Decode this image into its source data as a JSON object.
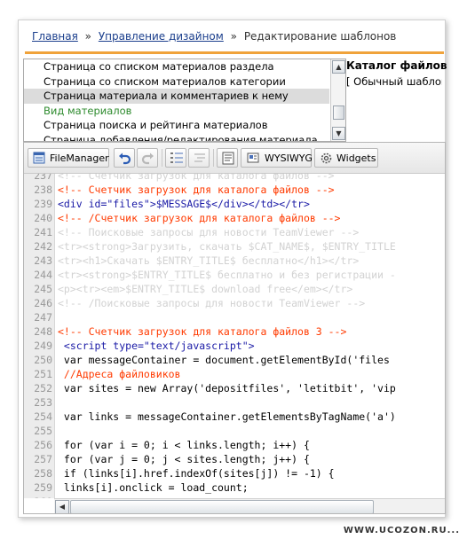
{
  "breadcrumb": {
    "home": "Главная",
    "sep1": "»",
    "design": "Управление дизайном",
    "sep2": "»",
    "current": "Редактирование шаблонов"
  },
  "template_list": {
    "items": [
      {
        "label": "Страница со списком материалов раздела"
      },
      {
        "label": "Страница со списком материалов категории"
      },
      {
        "label": "Страница материала и комментариев к нему"
      },
      {
        "label": "Вид материалов"
      },
      {
        "label": "Страница поиска и рейтинга материалов"
      },
      {
        "label": "Страница добавления/редактирования материала"
      }
    ],
    "selected_index": 2,
    "group_heading_index": 3,
    "scroll_up": "▲",
    "scroll_down": "▼"
  },
  "catalog": {
    "title": "Каталог файлов",
    "subtitle": "[ Обычный шаблон"
  },
  "toolbar": {
    "filemanager_label": "FileManager",
    "wysiwyg_label": "WYSIWYG",
    "widgets_label": "Widgets"
  },
  "code": {
    "lines": [
      {
        "n": "237",
        "t": "<!-- Счетчик загрузок для каталога файлов -->",
        "k": "faded"
      },
      {
        "n": "238",
        "t": "<!-- Счетчик загрузок для каталога файлов -->",
        "k": "comment"
      },
      {
        "n": "239",
        "t": "<div id=\"files\">$MESSAGE$</div></td></tr>",
        "k": "tag"
      },
      {
        "n": "240",
        "t": "<!-- /Счетчик загрузок для каталога файлов -->",
        "k": "comment"
      },
      {
        "n": "241",
        "t": "<!-- Поисковые запросы для новости TeamViewer -->",
        "k": "faded"
      },
      {
        "n": "242",
        "t": "<tr><strong>Загрузить, скачать $CAT_NAME$, $ENTRY_TITLE",
        "k": "faded"
      },
      {
        "n": "243",
        "t": "<tr><h1>Скачать $ENTRY_TITLE$ бесплатно</h1></tr>",
        "k": "faded"
      },
      {
        "n": "244",
        "t": "<tr><strong>$ENTRY_TITLE$ бесплатно и без регистрации -",
        "k": "faded"
      },
      {
        "n": "245",
        "t": "<p><tr><em>$ENTRY_TITLE$ download free</em></tr>",
        "k": "faded"
      },
      {
        "n": "246",
        "t": "<!-- /Поисковые запросы для новости TeamViewer -->",
        "k": "faded"
      },
      {
        "n": "247",
        "t": "",
        "k": "text"
      },
      {
        "n": "248",
        "t": "<!-- Счетчик загрузок для каталога файлов 3 -->",
        "k": "comment"
      },
      {
        "n": "249",
        "t": " <script type=\"text/javascript\">",
        "k": "tag"
      },
      {
        "n": "250",
        "t": " var messageContainer = document.getElementById('files",
        "k": "text"
      },
      {
        "n": "251",
        "t": " //Адреса файловиков",
        "k": "comment"
      },
      {
        "n": "252",
        "t": " var sites = new Array('depositfiles', 'letitbit', 'vip",
        "k": "text"
      },
      {
        "n": "253",
        "t": "",
        "k": "text"
      },
      {
        "n": "254",
        "t": " var links = messageContainer.getElementsByTagName('a')",
        "k": "text"
      },
      {
        "n": "255",
        "t": "",
        "k": "text"
      },
      {
        "n": "256",
        "t": " for (var i = 0; i < links.length; i++) {",
        "k": "text"
      },
      {
        "n": "257",
        "t": " for (var j = 0; j < sites.length; j++) {",
        "k": "text"
      },
      {
        "n": "258",
        "t": " if (links[i].href.indexOf(sites[j]) != -1) {",
        "k": "text"
      },
      {
        "n": "259",
        "t": " links[i].onclick = load_count;",
        "k": "text"
      },
      {
        "n": "260",
        "t": "",
        "k": "text"
      },
      {
        "n": "261",
        "t": "",
        "k": "text"
      }
    ]
  },
  "hscroll": {
    "left": "◀"
  },
  "watermark": "WWW.UCOZON.RU..."
}
